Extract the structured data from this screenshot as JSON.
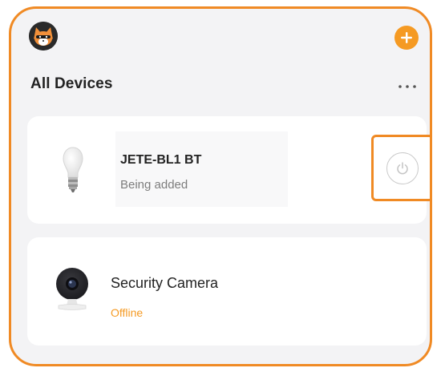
{
  "header": {
    "avatar_icon": "fox-avatar-icon",
    "add_icon": "plus-icon",
    "more_icon": "more-horizontal-icon",
    "accent_color": "#f59a23"
  },
  "section": {
    "title": "All Devices"
  },
  "devices": [
    {
      "name": "JETE-BL1 BT",
      "status": "Being added",
      "icon": "light-bulb-icon",
      "action_icon": "power-icon"
    },
    {
      "name": "Security Camera",
      "status": "Offline",
      "status_color": "#f59a23",
      "icon": "security-camera-icon"
    }
  ]
}
